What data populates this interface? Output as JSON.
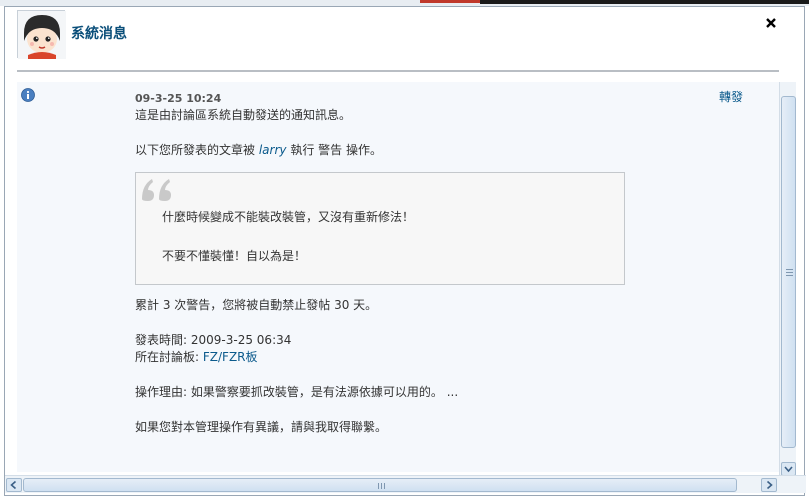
{
  "header": {
    "title": "系統消息"
  },
  "message": {
    "date": "09-3-25 10:24",
    "forward_label": "轉發",
    "intro": "這是由討論區系統自動發送的通知訊息。",
    "action_prefix": "以下您所發表的文章被",
    "action_user": "larry",
    "action_suffix": "執行 警告 操作。",
    "quote_line1": "什麼時候變成不能裝改裝管，又沒有重新修法！",
    "quote_line2": "不要不懂裝懂！自以為是！",
    "warning_count_text": "累計 3 次警告，您將被自動禁止發帖 30 天。",
    "post_time_label": "發表時間:",
    "post_time": "2009-3-25 06:34",
    "forum_label": "所在討論板:",
    "forum_name": "FZ/FZR板",
    "reason_label": "操作理由:",
    "reason_text": "如果警察要抓改裝管，是有法源依據可以用的。 ...",
    "appeal_text": "如果您對本管理操作有異議，請與我取得聯繫。"
  },
  "colors": {
    "title": "#0b4f7a",
    "link": "#0b5a8c",
    "content_bg": "#f5f8fc",
    "quote_bg": "#f7f7f7"
  },
  "icons": {
    "avatar": "avatar-cartoon-face",
    "info": "info-icon",
    "close": "close-icon",
    "quote": "quote-mark-icon"
  }
}
